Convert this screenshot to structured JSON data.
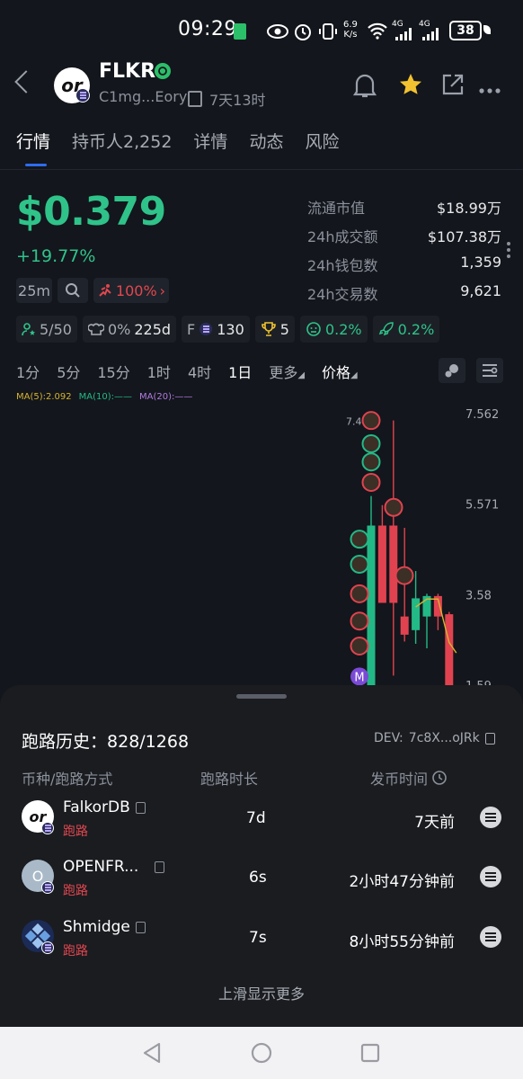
{
  "status_bar": {
    "time": "09:29",
    "network_speed_top": "6.9",
    "network_speed_unit": "K/s",
    "signal_1": "4G",
    "signal_2": "4G",
    "battery": "38"
  },
  "header": {
    "token_symbol": "FLKR",
    "logo_text": "or",
    "address_short": "C1mg...Eory",
    "age": "7天13时"
  },
  "tabs": [
    {
      "label": "行情",
      "active": true
    },
    {
      "label": "持币人2,252",
      "active": false
    },
    {
      "label": "详情",
      "active": false
    },
    {
      "label": "动态",
      "active": false
    },
    {
      "label": "风险",
      "active": false
    }
  ],
  "price": {
    "value": "$0.379",
    "change": "+19.77%",
    "interval_pill": "25m",
    "runner_pct": "100%"
  },
  "stats": [
    {
      "label": "流通市值",
      "value": "$18.99万"
    },
    {
      "label": "24h成交额",
      "value": "$107.38万"
    },
    {
      "label": "24h钱包数",
      "value": "1,359"
    },
    {
      "label": "24h交易数",
      "value": "9,621"
    }
  ],
  "badges": {
    "users": "5/50",
    "dev_pct": "0%",
    "dev_days": "225d",
    "f_label": "F",
    "f_value": "130",
    "trophy": "5",
    "face_pct": "0.2%",
    "rocket_pct": "0.2%"
  },
  "timeframes": [
    {
      "label": "1分",
      "active": false
    },
    {
      "label": "5分",
      "active": false
    },
    {
      "label": "15分",
      "active": false
    },
    {
      "label": "1时",
      "active": false
    },
    {
      "label": "4时",
      "active": false
    },
    {
      "label": "1日",
      "active": true
    },
    {
      "label": "更多",
      "active": false
    },
    {
      "label": "价格",
      "active": false
    }
  ],
  "ma": {
    "ma5": "MA(5):2.092",
    "ma10": "MA(10):——",
    "ma20": "MA(20):——"
  },
  "chart_data": {
    "type": "candlestick",
    "y_ticks": [
      "7.562",
      "5.571",
      "3.58",
      "1.59"
    ],
    "ylim": [
      1.59,
      7.562
    ],
    "high_label": "7.41",
    "marker_label": "M",
    "candles": [
      {
        "o": 1.59,
        "h": 5.75,
        "l": 1.59,
        "c": 5.1,
        "dir": "up"
      },
      {
        "o": 5.1,
        "h": 5.55,
        "l": 3.5,
        "c": 3.4,
        "dir": "down"
      },
      {
        "o": 3.4,
        "h": 7.41,
        "l": 1.8,
        "c": 5.1,
        "dir": "down"
      },
      {
        "o": 3.1,
        "h": 5.05,
        "l": 2.55,
        "c": 2.7,
        "dir": "down"
      },
      {
        "o": 2.8,
        "h": 4.1,
        "l": 2.5,
        "c": 3.5,
        "dir": "up"
      },
      {
        "o": 3.55,
        "h": 3.6,
        "l": 2.4,
        "c": 3.1,
        "dir": "up"
      },
      {
        "o": 3.55,
        "h": 3.6,
        "l": 2.8,
        "c": 3.1,
        "dir": "down"
      },
      {
        "o": 3.15,
        "h": 3.2,
        "l": 1.59,
        "c": 1.59,
        "dir": "down"
      }
    ],
    "colors": {
      "up": "#23b987",
      "down": "#e0434f",
      "ma": "#d6b431"
    }
  },
  "rug_history": {
    "title": "跑路历史：",
    "count": "828/1268",
    "dev_label": "DEV:",
    "dev_addr": "7c8X...oJRk",
    "col_token": "币种/跑路方式",
    "col_duration": "跑路时长",
    "col_time": "发币时间",
    "rows": [
      {
        "name": "FalkorDB",
        "tag": "跑路",
        "duration": "7d",
        "time": "7天前",
        "avatar_text": "or"
      },
      {
        "name": "OPENFR...",
        "tag": "跑路",
        "duration": "6s",
        "time": "2小时47分钟前",
        "avatar_text": "O"
      },
      {
        "name": "Shmidge",
        "tag": "跑路",
        "duration": "7s",
        "time": "8小时55分钟前",
        "avatar_text": ""
      }
    ],
    "more": "上滑显示更多"
  },
  "colors": {
    "green": "#2fc38a",
    "red": "#e2474f",
    "accent": "#2c6cf0",
    "bg": "#13161c"
  }
}
